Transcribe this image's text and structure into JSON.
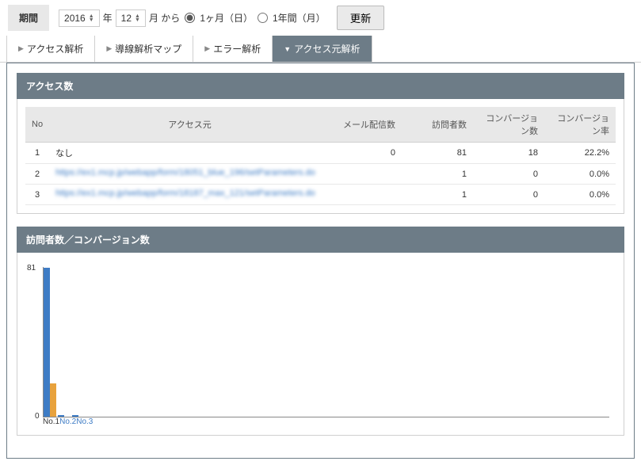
{
  "period": {
    "label": "期間",
    "year": "2016",
    "year_suffix": "年",
    "month": "12",
    "month_suffix": "月 から",
    "option_1month": "1ヶ月（日）",
    "option_1year": "1年間（月）",
    "update": "更新"
  },
  "tabs": [
    {
      "label": "アクセス解析",
      "active": false
    },
    {
      "label": "導線解析マップ",
      "active": false
    },
    {
      "label": "エラー解析",
      "active": false
    },
    {
      "label": "アクセス元解析",
      "active": true
    }
  ],
  "panel1": {
    "title": "アクセス数",
    "headers": [
      "No",
      "アクセス元",
      "メール配信数",
      "訪問者数",
      "コンバージョン数",
      "コンバージョン率"
    ],
    "rows": [
      {
        "no": "1",
        "src": "なし",
        "mail": "0",
        "visitors": "81",
        "conv": "18",
        "rate": "22.2%",
        "blurred": false
      },
      {
        "no": "2",
        "src": "https://ex1.mcp.jp/webapp/form/18051_blue_196/setParameters.do",
        "mail": "",
        "visitors": "1",
        "conv": "0",
        "rate": "0.0%",
        "blurred": true
      },
      {
        "no": "3",
        "src": "https://ex1.mcp.jp/webapp/form/18187_max_121/setParameters.do",
        "mail": "",
        "visitors": "1",
        "conv": "0",
        "rate": "0.0%",
        "blurred": true
      }
    ]
  },
  "panel2": {
    "title": "訪問者数／コンバージョン数"
  },
  "chart_data": {
    "type": "bar",
    "categories": [
      "No.1",
      "No.2",
      "No.3"
    ],
    "series": [
      {
        "name": "訪問者数",
        "values": [
          81,
          1,
          1
        ],
        "color": "#3e7cc5"
      },
      {
        "name": "コンバージョン数",
        "values": [
          18,
          0,
          0
        ],
        "color": "#e8a23d"
      }
    ],
    "ylim": [
      0,
      81
    ],
    "ymax_label": "81",
    "ymin_label": "0"
  }
}
